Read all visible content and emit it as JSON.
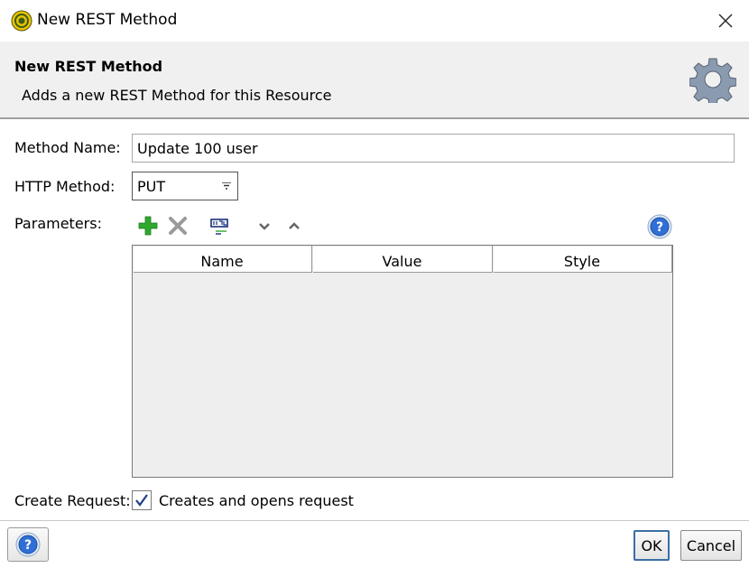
{
  "window": {
    "title": "New REST Method",
    "app_icon": "soapui-icon",
    "close_icon": "close-icon"
  },
  "header": {
    "title": "New REST Method",
    "subtitle": "Adds a new REST Method for this Resource",
    "icon": "gear-icon"
  },
  "form": {
    "method_name_label": "Method Name:",
    "method_name_value": "Update 100 user",
    "http_method_label": "HTTP Method:",
    "http_method_value": "PUT",
    "parameters_label": "Parameters:",
    "create_request_label": "Create Request:",
    "create_request_checkbox_label": "Creates and opens request",
    "create_request_checked": true
  },
  "parameters_toolbar": {
    "icons": [
      "add-icon",
      "remove-icon",
      "url-params-icon",
      "move-down-icon",
      "move-up-icon",
      "help-icon"
    ]
  },
  "parameters_table": {
    "columns": [
      "Name",
      "Value",
      "Style"
    ],
    "rows": []
  },
  "footer": {
    "help_icon": "help-icon",
    "ok_label": "OK",
    "cancel_label": "Cancel"
  },
  "colors": {
    "header_bg": "#f0f0f0",
    "add_green": "#2fa82f",
    "help_blue": "#2f6fd6",
    "focus_blue": "#3a6ea5"
  }
}
